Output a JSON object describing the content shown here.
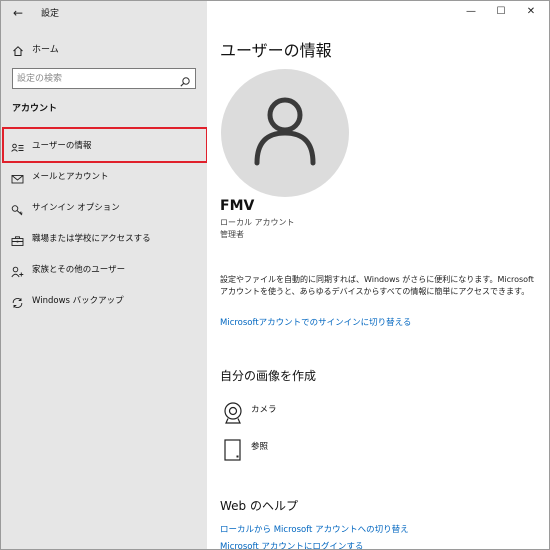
{
  "window": {
    "app_title": "設定",
    "back_glyph": "←",
    "minimize_glyph": "—",
    "maximize_glyph": "☐",
    "close_glyph": "✕"
  },
  "sidebar": {
    "home_label": "ホーム",
    "search_placeholder": "設定の検索",
    "section_label": "アカウント",
    "items": [
      {
        "label": "ユーザーの情報",
        "icon": "user-info-icon",
        "selected": true
      },
      {
        "label": "メールとアカウント",
        "icon": "mail-icon",
        "selected": false
      },
      {
        "label": "サインイン オプション",
        "icon": "key-icon",
        "selected": false
      },
      {
        "label": "職場または学校にアクセスする",
        "icon": "briefcase-icon",
        "selected": false
      },
      {
        "label": "家族とその他のユーザー",
        "icon": "person-add-icon",
        "selected": false
      },
      {
        "label": "Windows バックアップ",
        "icon": "sync-icon",
        "selected": false
      }
    ],
    "selected_outline_color": "#e0202b"
  },
  "main": {
    "title": "ユーザーの情報",
    "user": {
      "name": "FMV",
      "account_type": "ローカル アカウント",
      "role": "管理者"
    },
    "description": "設定やファイルを自動的に同期すれば、Windows がさらに便利になります。Microsoft アカウントを使うと、あらゆるデバイスからすべての情報に簡単にアクセスできます。",
    "signin_link": "Microsoftアカウントでのサインインに切り替える",
    "create_picture": {
      "title": "自分の画像を作成",
      "camera_label": "カメラ",
      "browse_label": "参照"
    },
    "web_help": {
      "title": "Web のヘルプ",
      "links": [
        "ローカルから Microsoft アカウントへの切り替え",
        "Microsoft アカウントにログインする"
      ]
    },
    "link_color": "#0066c0"
  }
}
